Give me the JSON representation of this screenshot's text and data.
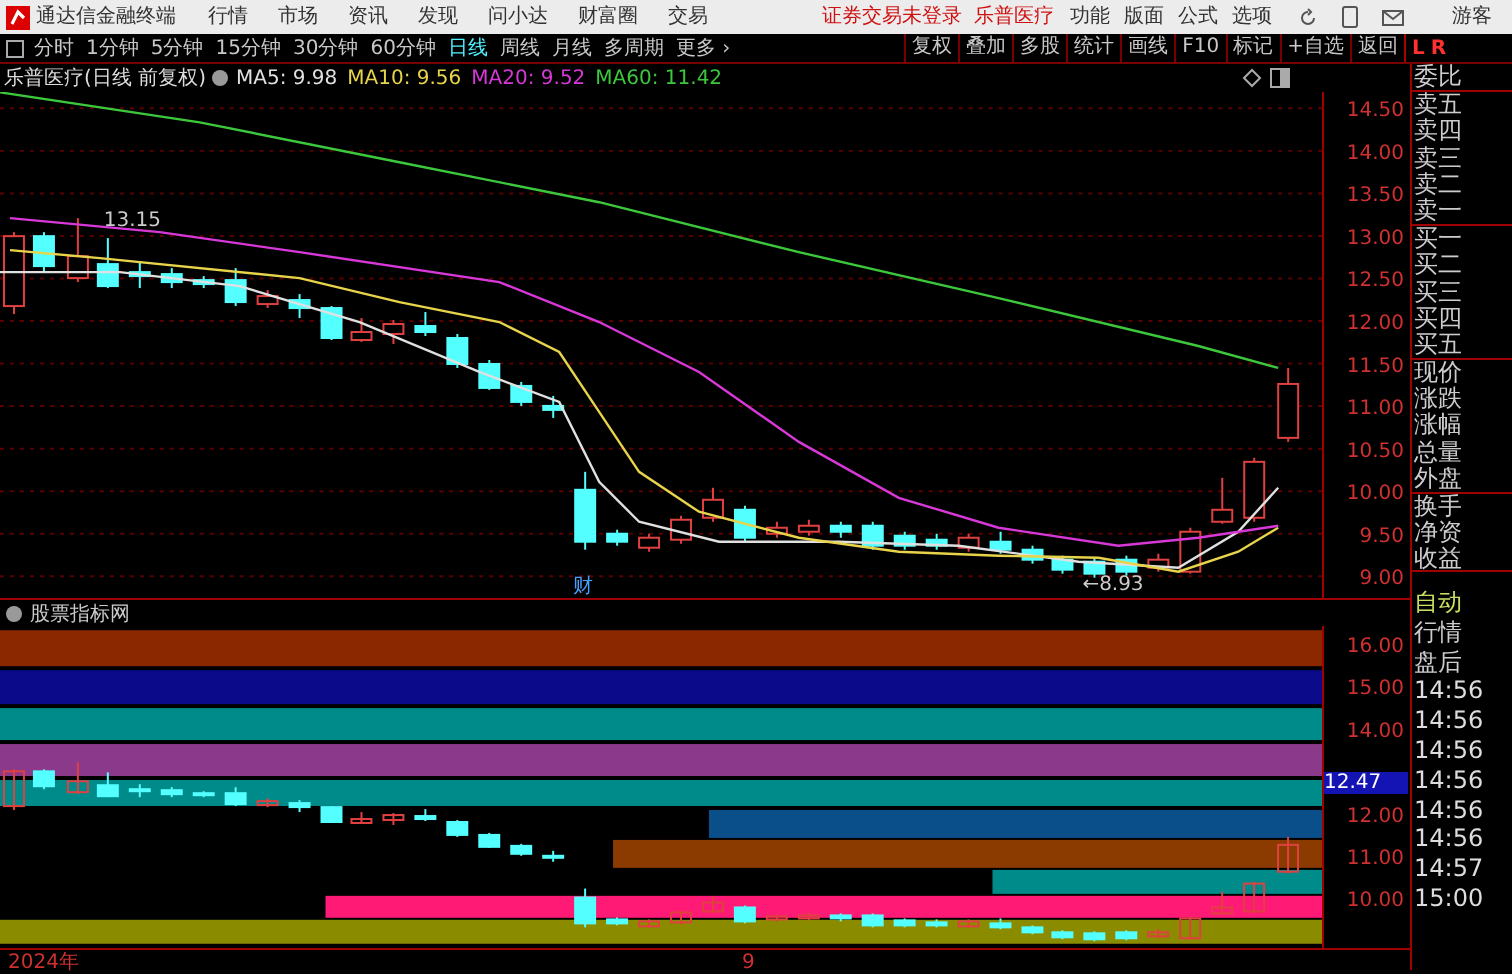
{
  "app": {
    "title": "通达信金融终端",
    "menu": [
      "行情",
      "市场",
      "资讯",
      "发现",
      "问小达",
      "财富圈",
      "交易"
    ],
    "login_notice": "证券交易未登录",
    "stock_name": "乐普医疗",
    "right_menu": [
      "功能",
      "版面",
      "公式",
      "选项"
    ],
    "user": "游客"
  },
  "periods": [
    {
      "label": "分时",
      "selected": false
    },
    {
      "label": "1分钟",
      "selected": false
    },
    {
      "label": "5分钟",
      "selected": false
    },
    {
      "label": "15分钟",
      "selected": false
    },
    {
      "label": "30分钟",
      "selected": false
    },
    {
      "label": "60分钟",
      "selected": false
    },
    {
      "label": "日线",
      "selected": true
    },
    {
      "label": "周线",
      "selected": false
    },
    {
      "label": "月线",
      "selected": false
    },
    {
      "label": "多周期",
      "selected": false
    },
    {
      "label": "更多 ›",
      "selected": false
    }
  ],
  "tools": [
    "复权",
    "叠加",
    "多股",
    "统计",
    "画线",
    "F10",
    "标记",
    "+自选",
    "返回"
  ],
  "corner": {
    "left": "L",
    "right": "R"
  },
  "chart": {
    "title": "乐普医疗(日线 前复权)",
    "ma": [
      {
        "label": "MA5: 9.98",
        "color": "#e0e0e0"
      },
      {
        "label": "MA10: 9.56",
        "color": "#e8d44a"
      },
      {
        "label": "MA20: 9.52",
        "color": "#d838d8"
      },
      {
        "label": "MA60: 11.42",
        "color": "#3cc83c"
      }
    ],
    "price_ticks": [
      "14.50",
      "14.00",
      "13.50",
      "13.00",
      "12.50",
      "12.00",
      "11.50",
      "11.00",
      "10.50",
      "10.00",
      "9.50",
      "9.00"
    ],
    "high_label": "13.15",
    "low_label": "←8.93",
    "event_marker": "财",
    "dates": [
      "2024年",
      "9"
    ]
  },
  "indicator": {
    "title": "股票指标网",
    "ticks": [
      "16.00",
      "15.00",
      "14.00",
      "12.00",
      "11.00",
      "10.00"
    ],
    "current": "12.47"
  },
  "quote_panel": {
    "labels": [
      "委比",
      "卖五",
      "卖四",
      "卖三",
      "卖二",
      "卖一",
      "买一",
      "买二",
      "买三",
      "买四",
      "买五",
      "现价",
      "涨跌",
      "涨幅",
      "总量",
      "外盘",
      "换手",
      "净资",
      "收益"
    ],
    "status": [
      {
        "label": "自动",
        "kind": "mode"
      },
      {
        "label": "行情",
        "kind": "plain"
      },
      {
        "label": "盘后",
        "kind": "plain"
      }
    ],
    "times": [
      "14:56",
      "14:56",
      "14:56",
      "14:56",
      "14:56",
      "14:56",
      "14:57",
      "15:00"
    ]
  }
}
